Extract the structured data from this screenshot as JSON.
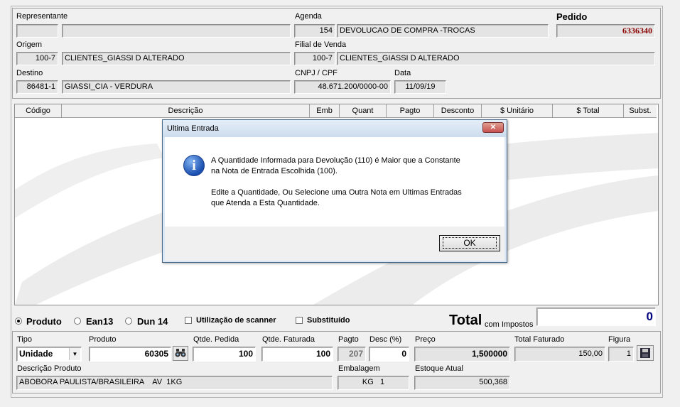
{
  "header": {
    "representante_label": "Representante",
    "representante_code": "",
    "representante_name": "",
    "agenda_label": "Agenda",
    "agenda_code": "154",
    "agenda_desc": "DEVOLUCAO DE COMPRA -TROCAS",
    "pedido_label": "Pedido",
    "pedido_value": "6336340",
    "origem_label": "Origem",
    "origem_code": "100-7",
    "origem_name": "CLIENTES_GIASSI D ALTERADO",
    "filial_label": "Filial de Venda",
    "filial_code": "100-7",
    "filial_name": "CLIENTES_GIASSI D ALTERADO",
    "destino_label": "Destino",
    "destino_code": "86481-1",
    "destino_name": "GIASSI_CIA - VERDURA",
    "cnpj_label": "CNPJ / CPF",
    "cnpj_value": "48.671.200/0000-00",
    "data_label": "Data",
    "data_value": "11/09/19"
  },
  "grid": {
    "columns": [
      "Código",
      "Descrição",
      "Emb",
      "Quant",
      "Pagto",
      "Desconto",
      "$ Unitário",
      "$ Total",
      "Subst."
    ]
  },
  "options": {
    "produto": "Produto",
    "ean13": "Ean13",
    "dun14": "Dun 14",
    "scanner": "Utilização de scanner",
    "substituido": "Substituído",
    "total_label": "Total",
    "total_sub": "com Impostos",
    "total_value": "0"
  },
  "item": {
    "tipo_label": "Tipo",
    "tipo_value": "Unidade",
    "produto_label": "Produto",
    "produto_value": "60305",
    "qtde_pedida_label": "Qtde. Pedida",
    "qtde_pedida_value": "100",
    "qtde_faturada_label": "Qtde. Faturada",
    "qtde_faturada_value": "100",
    "pagto_label": "Pagto",
    "pagto_value": "207",
    "desc_label": "Desc (%)",
    "desc_value": "0",
    "preco_label": "Preço",
    "preco_value": "1,500000",
    "total_faturado_label": "Total Faturado",
    "total_faturado_value": "150,00",
    "figura_label": "Figura",
    "figura_value": "1",
    "descricao_label": "Descrição Produto",
    "descricao_value": "ABOBORA PAULISTA/BRASILEIRA    AV  1KG",
    "embalagem_label": "Embalagem",
    "embalagem_value": "KG   1",
    "estoque_label": "Estoque Atual",
    "estoque_value": "500,368"
  },
  "dialog": {
    "title": "Ultima Entrada",
    "line1": "A Quantidade Informada para Devolução (110) é Maior que a Constante",
    "line2": "na Nota de Entrada Escolhida (100).",
    "line3": "Edite a Quantidade, Ou Selecione uma Outra Nota em Ultimas Entradas",
    "line4": "que Atenda a Esta Quantidade.",
    "ok_label": "OK",
    "close_label": "✕"
  },
  "icons": {
    "info": "info-icon",
    "binoculars": "binoculars-icon",
    "save": "floppy-disk-icon"
  },
  "colors": {
    "pedido": "#8b0000",
    "total": "#000080",
    "dialog_title_bg": "#dce8f5",
    "close_btn": "#c75050"
  }
}
